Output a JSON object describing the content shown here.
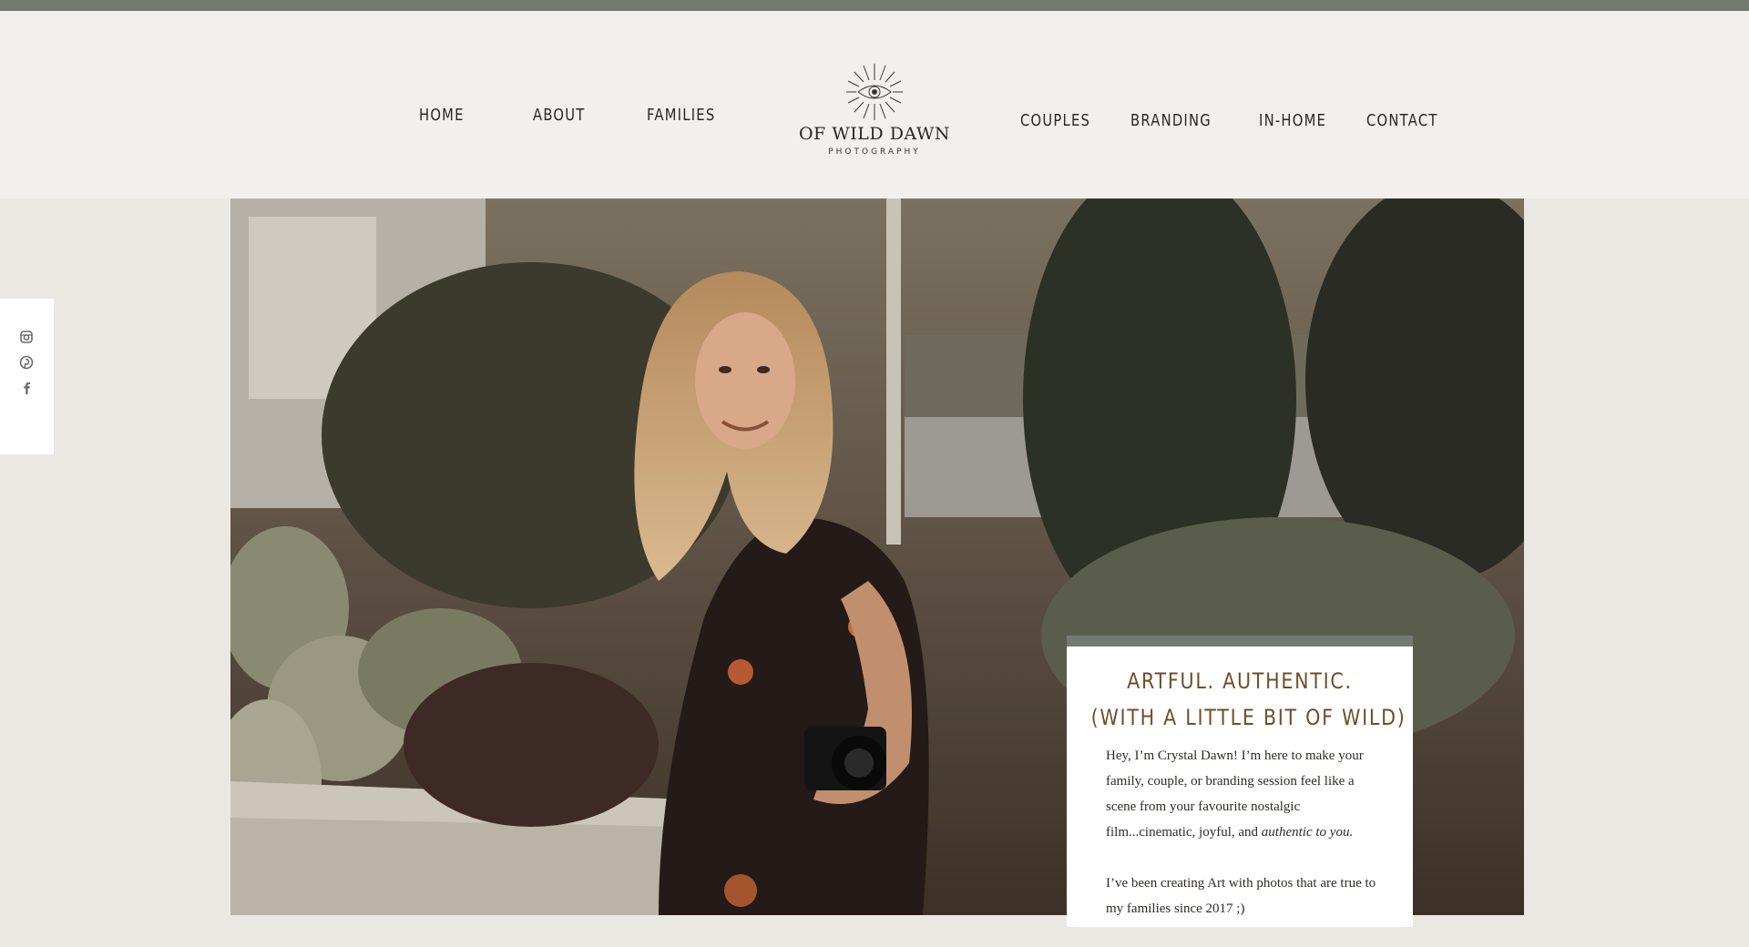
{
  "nav": {
    "left": [
      "HOME",
      "ABOUT",
      "FAMILIES"
    ],
    "right": [
      "COUPLES",
      "BRANDING",
      "IN-HOME",
      "CONTACT"
    ]
  },
  "logo": {
    "name": "OF WILD DAWN",
    "subtitle": "PHOTOGRAPHY",
    "icon": "sun-eye-icon"
  },
  "social": {
    "icons": [
      "instagram-icon",
      "pinterest-icon",
      "facebook-icon"
    ]
  },
  "hero": {
    "image": "photographer-with-camera-among-succulents"
  },
  "intro_card": {
    "title_line1": "ARTFUL. AUTHENTIC.",
    "title_line2": "(WITH A LITTLE BIT OF WILD)",
    "para1_plain": "Hey, I’m Crystal Dawn! I’m here to make your family, couple, or branding session feel like a scene from your favourite nostalgic film...cinematic, joyful, and ",
    "para1_italic": "authentic to you.",
    "para2": "I’ve been creating Art with photos that are true to my families since 2017 ;)"
  },
  "colors": {
    "accent_bar": "#747a71",
    "header_bg": "#f2efec",
    "page_bg": "#ebe8e4",
    "title_brown": "#6f4f28"
  }
}
